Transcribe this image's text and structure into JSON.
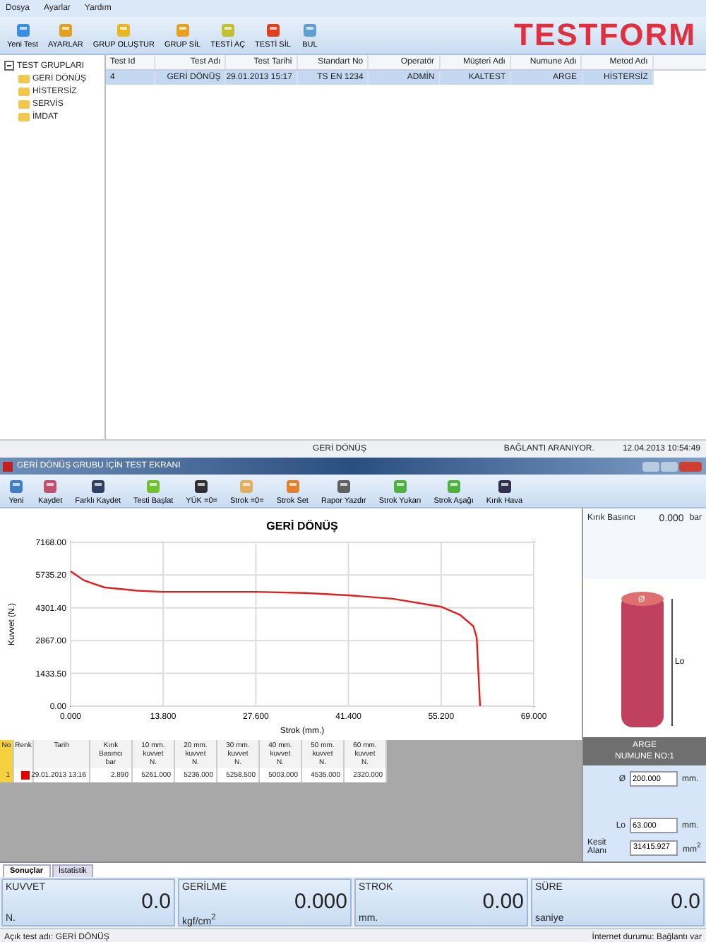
{
  "menu": [
    "Dosya",
    "Ayarlar",
    "Yardım"
  ],
  "toolbar": [
    "Yeni Test",
    "AYARLAR",
    "GRUP OLUŞTUR",
    "GRUP SİL",
    "TESTİ AÇ",
    "TESTİ SİL",
    "BUL"
  ],
  "logo": "TESTFORM",
  "tree": {
    "label": "TEST GRUPLARI",
    "expanded": true,
    "children": [
      {
        "label": "GERİ DÖNÜŞ"
      },
      {
        "label": "HİSTERSİZ"
      },
      {
        "label": "SERVİS"
      },
      {
        "label": "İMDAT"
      }
    ]
  },
  "table": {
    "columns": [
      "Test Id",
      "Test Adı",
      "Test Tarihi",
      "Standart No",
      "Operatör",
      "Müşteri Adı",
      "Numune Adı",
      "Metod Adı"
    ],
    "rows": [
      {
        "selected": true,
        "cells": [
          "4",
          "GERİ DÖNÜŞ",
          "29.01.2013 15:17",
          "TS EN 1234",
          "ADMİN",
          "KALTEST",
          "ARGE",
          "HİSTERSİZ"
        ]
      }
    ]
  },
  "status_bar": {
    "group": "GERİ DÖNÜŞ",
    "connection": "BAĞLANTI ARANIYOR.",
    "datetime": "12.04.2013 10:54:49"
  },
  "test_window": {
    "title": "GERİ DÖNÜŞ GRUBU İÇİN TEST EKRANI",
    "toolbar": [
      "Yeni",
      "Kaydet",
      "Farklı Kaydet",
      "Testi Başlat",
      "YÜK =0=",
      "Strok =0=",
      "Strok Set",
      "Rapor Yazdır",
      "Strok Yukarı",
      "Strok Aşağı",
      "Kırık Hava"
    ],
    "chart_data": {
      "type": "line",
      "title": "GERİ DÖNÜŞ",
      "xlabel": "Strok (mm.)",
      "ylabel": "Kuvvet (N.)",
      "x": [
        0,
        2,
        5,
        10,
        13.8,
        20,
        27.6,
        35,
        41.4,
        48,
        55.2,
        58,
        60,
        60.5,
        61
      ],
      "grid": true,
      "series": [
        {
          "color": "#e02020",
          "values": [
            5900,
            5500,
            5200,
            5050,
            5000,
            5000,
            5000,
            4950,
            4850,
            4700,
            4350,
            4000,
            3500,
            3000,
            0
          ]
        }
      ],
      "xlim": [
        0,
        69
      ],
      "ylim": [
        0,
        7168
      ],
      "xticks": [
        {
          "value": 0,
          "label": "0.000"
        },
        {
          "value": 13.8,
          "label": "13.800"
        },
        {
          "value": 27.6,
          "label": "27.600"
        },
        {
          "value": 41.4,
          "label": "41.400"
        },
        {
          "value": 55.2,
          "label": "55.200"
        },
        {
          "value": 69,
          "label": "69.000"
        }
      ],
      "yticks": [
        {
          "value": 0,
          "label": "0.00"
        },
        {
          "value": 1433.5,
          "label": "1433.50"
        },
        {
          "value": 2867,
          "label": "2867.00"
        },
        {
          "value": 4301.4,
          "label": "4301.40"
        },
        {
          "value": 5735.2,
          "label": "5735.20"
        },
        {
          "value": 7168,
          "label": "7168.00"
        }
      ]
    },
    "results": {
      "columns": [
        "No",
        "Renk",
        "Tarih",
        "Kırık\nBasıncı\nbar",
        "10 mm.\nkuvvet\nN.",
        "20 mm.\nkuvvet\nN.",
        "30 mm.\nkuvvet\nN.",
        "40 mm.\nkuvvet\nN.",
        "50 mm.\nkuvvet\nN.",
        "60 mm.\nkuvvet\nN."
      ],
      "rows": [
        {
          "color": "#e00000",
          "cells": [
            "1",
            "",
            "29.01.2013 13:16",
            "2.890",
            "5261.000",
            "5236.000",
            "5258.500",
            "5003.000",
            "4535.000",
            "2320.000"
          ]
        }
      ]
    },
    "tabs": [
      {
        "label": "Sonuçlar",
        "selected": true
      },
      {
        "label": "İstatistik",
        "selected": false
      }
    ],
    "readouts": [
      {
        "label": "KUVVET",
        "value": "0.0",
        "unit": "N."
      },
      {
        "label": "GERİLME",
        "value": "0.000",
        "unit": "kgf/cm$^{2}$"
      },
      {
        "label": "STROK",
        "value": "0.00",
        "unit": "mm."
      },
      {
        "label": "SÜRE",
        "value": "0.0",
        "unit": "saniye"
      }
    ],
    "side": {
      "pressure_label": "Kırık Basıncı",
      "pressure_value": "0.000",
      "pressure_unit": "bar",
      "diameter_mark": "Ø",
      "length_mark": "Lo",
      "sample": "ARGE",
      "sample_no": "NUMUNE NO:1",
      "fields": [
        {
          "label": "Ø",
          "value": "200.000",
          "unit": "mm."
        },
        {
          "label": "Lo",
          "value": "63.000",
          "unit": "mm."
        },
        {
          "label": "Kesit Alanı",
          "value": "31415.927",
          "unit": "mm$^{2}$"
        }
      ]
    },
    "footer": {
      "open_test": "Açık test adı:  GERİ DÖNÜŞ",
      "internet": "İnternet durumu:  Bağlantı var"
    }
  }
}
